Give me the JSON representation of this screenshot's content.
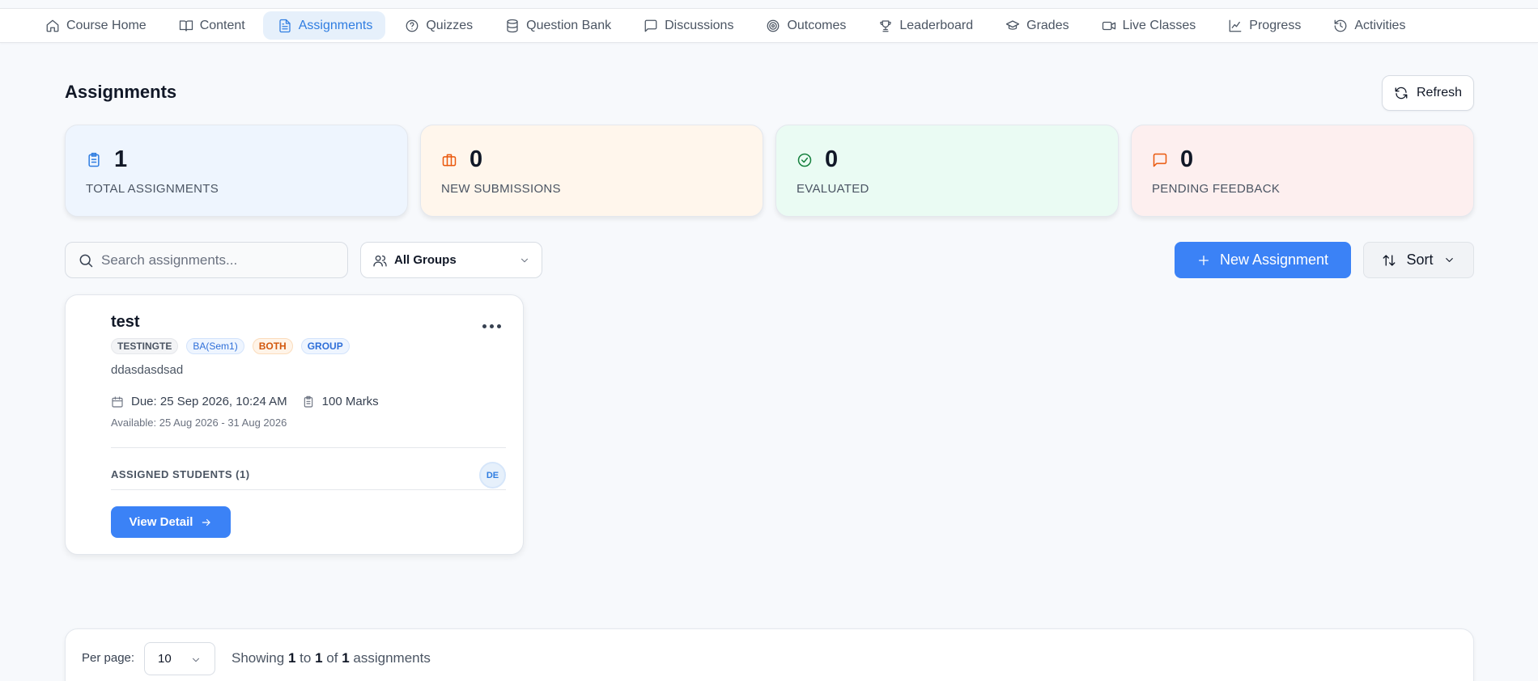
{
  "nav": {
    "tabs": [
      {
        "label": "Course Home",
        "icon": "home-icon"
      },
      {
        "label": "Content",
        "icon": "book-icon"
      },
      {
        "label": "Assignments",
        "icon": "file-text-icon",
        "active": true
      },
      {
        "label": "Quizzes",
        "icon": "help-circle-icon"
      },
      {
        "label": "Question Bank",
        "icon": "database-icon"
      },
      {
        "label": "Discussions",
        "icon": "message-square-icon"
      },
      {
        "label": "Outcomes",
        "icon": "target-icon"
      },
      {
        "label": "Leaderboard",
        "icon": "trophy-icon"
      },
      {
        "label": "Grades",
        "icon": "graduation-cap-icon"
      },
      {
        "label": "Live Classes",
        "icon": "video-icon"
      },
      {
        "label": "Progress",
        "icon": "line-chart-icon"
      },
      {
        "label": "Activities",
        "icon": "history-icon"
      }
    ]
  },
  "page": {
    "title": "Assignments",
    "refresh_label": "Refresh"
  },
  "stats": [
    {
      "value": "1",
      "label": "TOTAL ASSIGNMENTS",
      "icon": "clipboard-list-icon",
      "bg": "#eef5fe",
      "color": "#2f7de1"
    },
    {
      "value": "0",
      "label": "NEW SUBMISSIONS",
      "icon": "briefcase-icon",
      "bg": "#fff6ec",
      "color": "#ea580c"
    },
    {
      "value": "0",
      "label": "EVALUATED",
      "icon": "check-circle-icon",
      "bg": "#eafbf3",
      "color": "#15803d"
    },
    {
      "value": "0",
      "label": "PENDING FEEDBACK",
      "icon": "message-square-icon",
      "bg": "#fdefef",
      "color": "#ea580c"
    }
  ],
  "toolbar": {
    "search_placeholder": "Search assignments...",
    "group_filter": "All Groups",
    "new_assignment_label": "New Assignment",
    "sort_label": "Sort"
  },
  "assignments": [
    {
      "title": "test",
      "tags": [
        "TESTINGTE",
        "BA(Sem1)",
        "BOTH",
        "GROUP"
      ],
      "description": "ddasdasdsad",
      "due": "Due: 25 Sep 2026, 10:24 AM",
      "marks": "100 Marks",
      "available": "Available: 25 Aug 2026 - 31 Aug 2026",
      "assigned_label": "ASSIGNED STUDENTS (1)",
      "avatar_initials": "DE",
      "view_detail_label": "View Detail"
    }
  ],
  "pagination": {
    "per_page_label": "Per page:",
    "per_page_value": "10",
    "showing_prefix": "Showing",
    "from": "1",
    "to_word": "to",
    "to": "1",
    "of_word": "of",
    "total": "1",
    "suffix": "assignments"
  }
}
